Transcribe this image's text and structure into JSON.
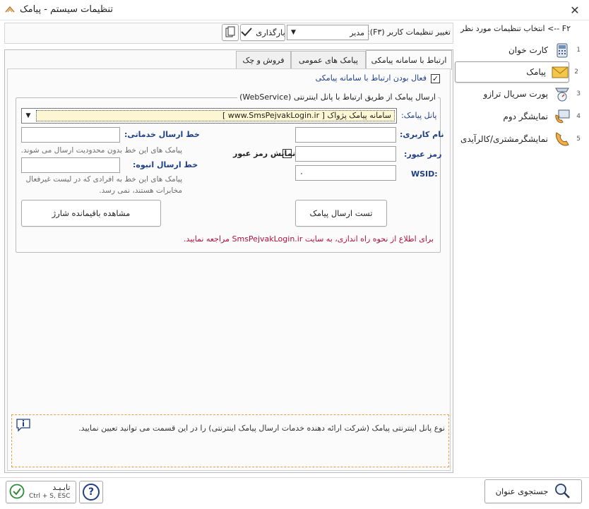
{
  "window": {
    "title": "تنظیمات سیستم - پیامک",
    "close_glyph": "✕"
  },
  "sidebar": {
    "header": "F۲ --> انتخاب تنظیمات مورد نظر",
    "items": [
      {
        "num": "1",
        "label": "کارت خوان"
      },
      {
        "num": "2",
        "label": "پیامک"
      },
      {
        "num": "3",
        "label": "پورت سریال ترازو"
      },
      {
        "num": "4",
        "label": "نمایشگر دوم"
      },
      {
        "num": "5",
        "label": "نمایشگرمشتری/کالرآیدی"
      }
    ]
  },
  "toolbar": {
    "user_settings_label": "تغییر تنظیمات کاربر (F۳):",
    "user_value": "مدیر",
    "load_label": "بارگذاری"
  },
  "tabs": [
    {
      "label": "ارتباط با سامانه پیامکی"
    },
    {
      "label": "پیامک های عمومی"
    },
    {
      "label": "فروش و چک"
    }
  ],
  "sms": {
    "enable_label": "فعال بودن ارتباط با سامانه پیامکی",
    "enable_checked": true,
    "group_title": "ارسال پیامک از طریق ارتباط با پانل اینترنتی (WebService)",
    "panel_label": "پانل پیامک:",
    "panel_value": "سامانه پیامک پژواک [ www.SmsPejvakLogin.ir ]",
    "username_label": "نام کاربری:",
    "username_value": "",
    "password_label": "رمز عبور:",
    "password_value": "",
    "show_password_label": "نمایش رمز عبور",
    "wsid_label": "WSID:",
    "wsid_value": "۰",
    "service_line_label": "خط ارسال خدماتی:",
    "service_line_value": "",
    "service_line_hint": "پیامک های این خط بدون محدودیت ارسال می شوند.",
    "bulk_line_label": "خط ارسال انبوه:",
    "bulk_line_value": "",
    "bulk_line_hint": "پیامک های این خط به افرادی که در لیست غیرفعال مخابرات  هستند، نمی رسد.",
    "test_button": "تست ارسال پیامک",
    "charge_button": "مشاهده باقیمانده شارژ",
    "info_prefix": "برای اطلاع از نحوه راه اندازی، به سایت ",
    "info_link": "SmsPejvakLogin.ir",
    "info_suffix": " مراجعه نمایید."
  },
  "help_box": {
    "text": "نوع پانل اینترنتی پیامک (شرکت ارائه دهنده خدمات ارسال پیامک اینترنتی) را در این قسمت می توانید تعیین نمایید."
  },
  "footer": {
    "confirm_label": "تایـیـد",
    "confirm_shortcut": "Ctrl + S, ESC",
    "help_glyph": "?",
    "search_label": "جستجوی عنوان"
  },
  "colors": {
    "accent_blue": "#1f3f86",
    "link_red": "#b0103a",
    "dropdown_bg": "#fdf6d2",
    "help_border": "#e8a040"
  }
}
